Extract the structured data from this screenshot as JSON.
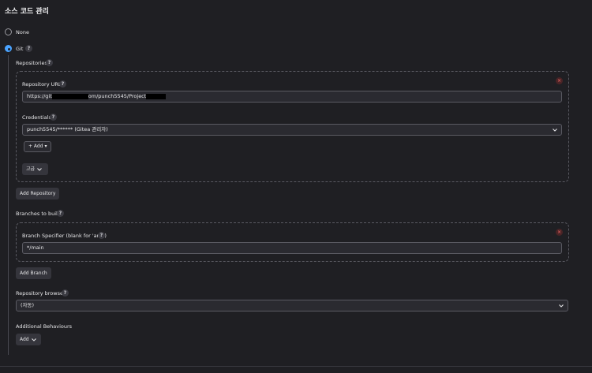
{
  "section_title": "소스 코드 관리",
  "scm_options": {
    "none_label": "None",
    "git_label": "Git"
  },
  "help_glyph": "?",
  "repositories": {
    "label": "Repositories",
    "repo_url_label": "Repository URL",
    "repo_url_value_start": "https://git",
    "repo_url_value_mid": "om/punch5545/Project",
    "credentials_label": "Credentials",
    "credentials_value": "punch5545/****** (Gitea 관리자)",
    "add_label": "+ Add ▾",
    "advanced_label": "고급",
    "add_repository_label": "Add Repository",
    "delete_glyph": "×"
  },
  "branches": {
    "label": "Branches to build",
    "specifier_label": "Branch Specifier (blank for 'any')",
    "specifier_value": "*/main",
    "add_branch_label": "Add Branch",
    "delete_glyph": "×"
  },
  "repository_browser": {
    "label": "Repository browser",
    "selected": "(자동)"
  },
  "additional_behaviours": {
    "label": "Additional Behaviours",
    "add_label": "Add"
  },
  "colors": {
    "background": "#1f1f23",
    "accent": "#4aa3ff",
    "danger": "#ff6b6b"
  }
}
